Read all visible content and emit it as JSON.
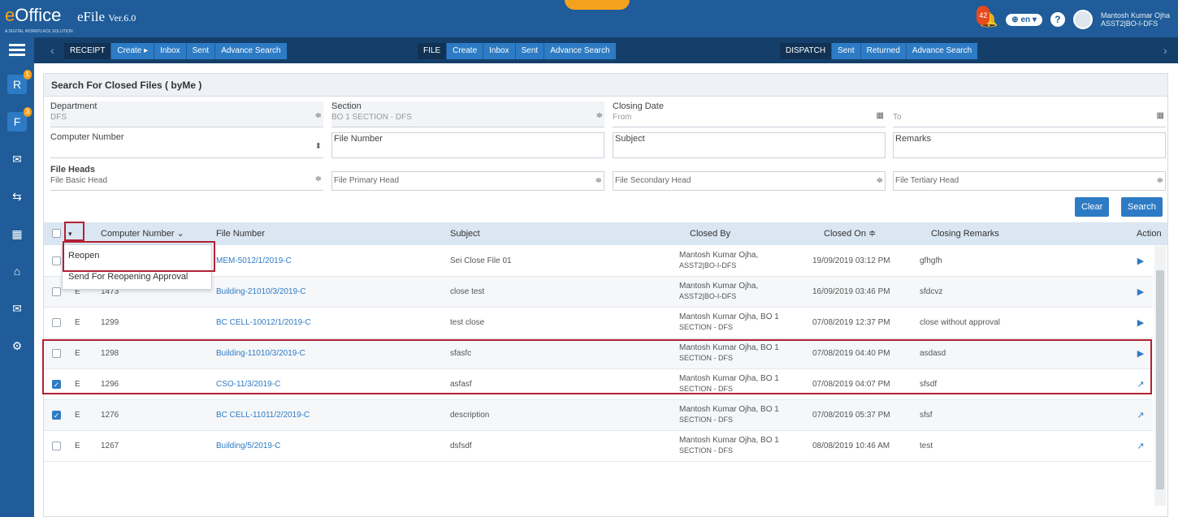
{
  "header": {
    "logo_prefix": "e",
    "logo_word": "Office",
    "logo_tagline": "A DIGITAL WORKPLACE SOLUTION",
    "app_name": "eFile",
    "version": "Ver.6.0",
    "notification_count": "42",
    "language": "en",
    "user_name": "Mantosh Kumar Ojha",
    "user_post": "ASST2|BO-I-DFS"
  },
  "sidebar": {
    "badges": [
      "1",
      "3"
    ]
  },
  "nav": {
    "receipt": {
      "head": "RECEIPT",
      "links": [
        "Create ▸",
        "Inbox",
        "Sent",
        "Advance Search"
      ]
    },
    "file": {
      "head": "FILE",
      "links": [
        "Create",
        "Inbox",
        "Sent",
        "Advance Search"
      ]
    },
    "dispatch": {
      "head": "DISPATCH",
      "links": [
        "Sent",
        "Returned",
        "Advance Search"
      ]
    }
  },
  "panel": {
    "title": "Search For Closed Files ( byMe )",
    "department": {
      "label": "Department",
      "value": "DFS"
    },
    "section": {
      "label": "Section",
      "value": "BO 1 SECTION - DFS"
    },
    "closing_date": {
      "label": "Closing Date",
      "from": "From",
      "to": "To"
    },
    "computer_number": {
      "label": "Computer Number"
    },
    "file_number": {
      "label": "File Number"
    },
    "subject": {
      "label": "Subject"
    },
    "remarks": {
      "label": "Remarks"
    },
    "file_heads": {
      "label": "File Heads",
      "basic": "File Basic Head",
      "primary": "File Primary Head",
      "secondary": "File Secondary Head",
      "tertiary": "File Tertiary Head"
    },
    "clear_label": "Clear",
    "search_label": "Search"
  },
  "table": {
    "headers": [
      "Computer Number ⌄",
      "File Number",
      "Subject",
      "Closed By",
      "Closed On ≑",
      "Closing Remarks",
      "Action"
    ],
    "rows": [
      {
        "type": "",
        "computer": "",
        "file": "MEM-5012/1/2019-C",
        "subject": "Sei Close File 01",
        "by1": "Mantosh Kumar Ojha,",
        "by2": "ASST2|BO-I-DFS",
        "on": "19/09/2019 03:12 PM",
        "remarks": "gfhgfh",
        "checked": false
      },
      {
        "type": "E",
        "computer": "1473",
        "file": "Building-21010/3/2019-C",
        "subject": "close test",
        "by1": "Mantosh Kumar Ojha,",
        "by2": "ASST2|BO-I-DFS",
        "on": "16/09/2019 03:46 PM",
        "remarks": "sfdcvz",
        "checked": false
      },
      {
        "type": "E",
        "computer": "1299",
        "file": "BC CELL-10012/1/2019-C",
        "subject": "test close",
        "by1": "Mantosh Kumar Ojha, BO 1",
        "by2": "SECTION - DFS",
        "on": "07/08/2019 12:37 PM",
        "remarks": "close without approval",
        "checked": false
      },
      {
        "type": "E",
        "computer": "1298",
        "file": "Building-11010/3/2019-C",
        "subject": "sfasfc",
        "by1": "Mantosh Kumar Ojha, BO 1",
        "by2": "SECTION - DFS",
        "on": "07/08/2019 04:40 PM",
        "remarks": "asdasd",
        "checked": false
      },
      {
        "type": "E",
        "computer": "1296",
        "file": "CSO-11/3/2019-C",
        "subject": "asfasf",
        "by1": "Mantosh Kumar Ojha, BO 1",
        "by2": "SECTION - DFS",
        "on": "07/08/2019 04:07 PM",
        "remarks": "sfsdf",
        "checked": true
      },
      {
        "type": "E",
        "computer": "1276",
        "file": "BC CELL-11011/2/2019-C",
        "subject": "description",
        "by1": "Mantosh Kumar Ojha, BO 1",
        "by2": "SECTION - DFS",
        "on": "07/08/2019 05:37 PM",
        "remarks": "sfsf",
        "checked": true
      },
      {
        "type": "E",
        "computer": "1267",
        "file": "Building/5/2019-C",
        "subject": "dsfsdf",
        "by1": "Mantosh Kumar Ojha, BO 1",
        "by2": "SECTION - DFS",
        "on": "08/08/2019 10:46 AM",
        "remarks": "test",
        "checked": false
      }
    ]
  },
  "dropdown": {
    "items": [
      "Reopen",
      "Send For Reopening Approval"
    ]
  }
}
